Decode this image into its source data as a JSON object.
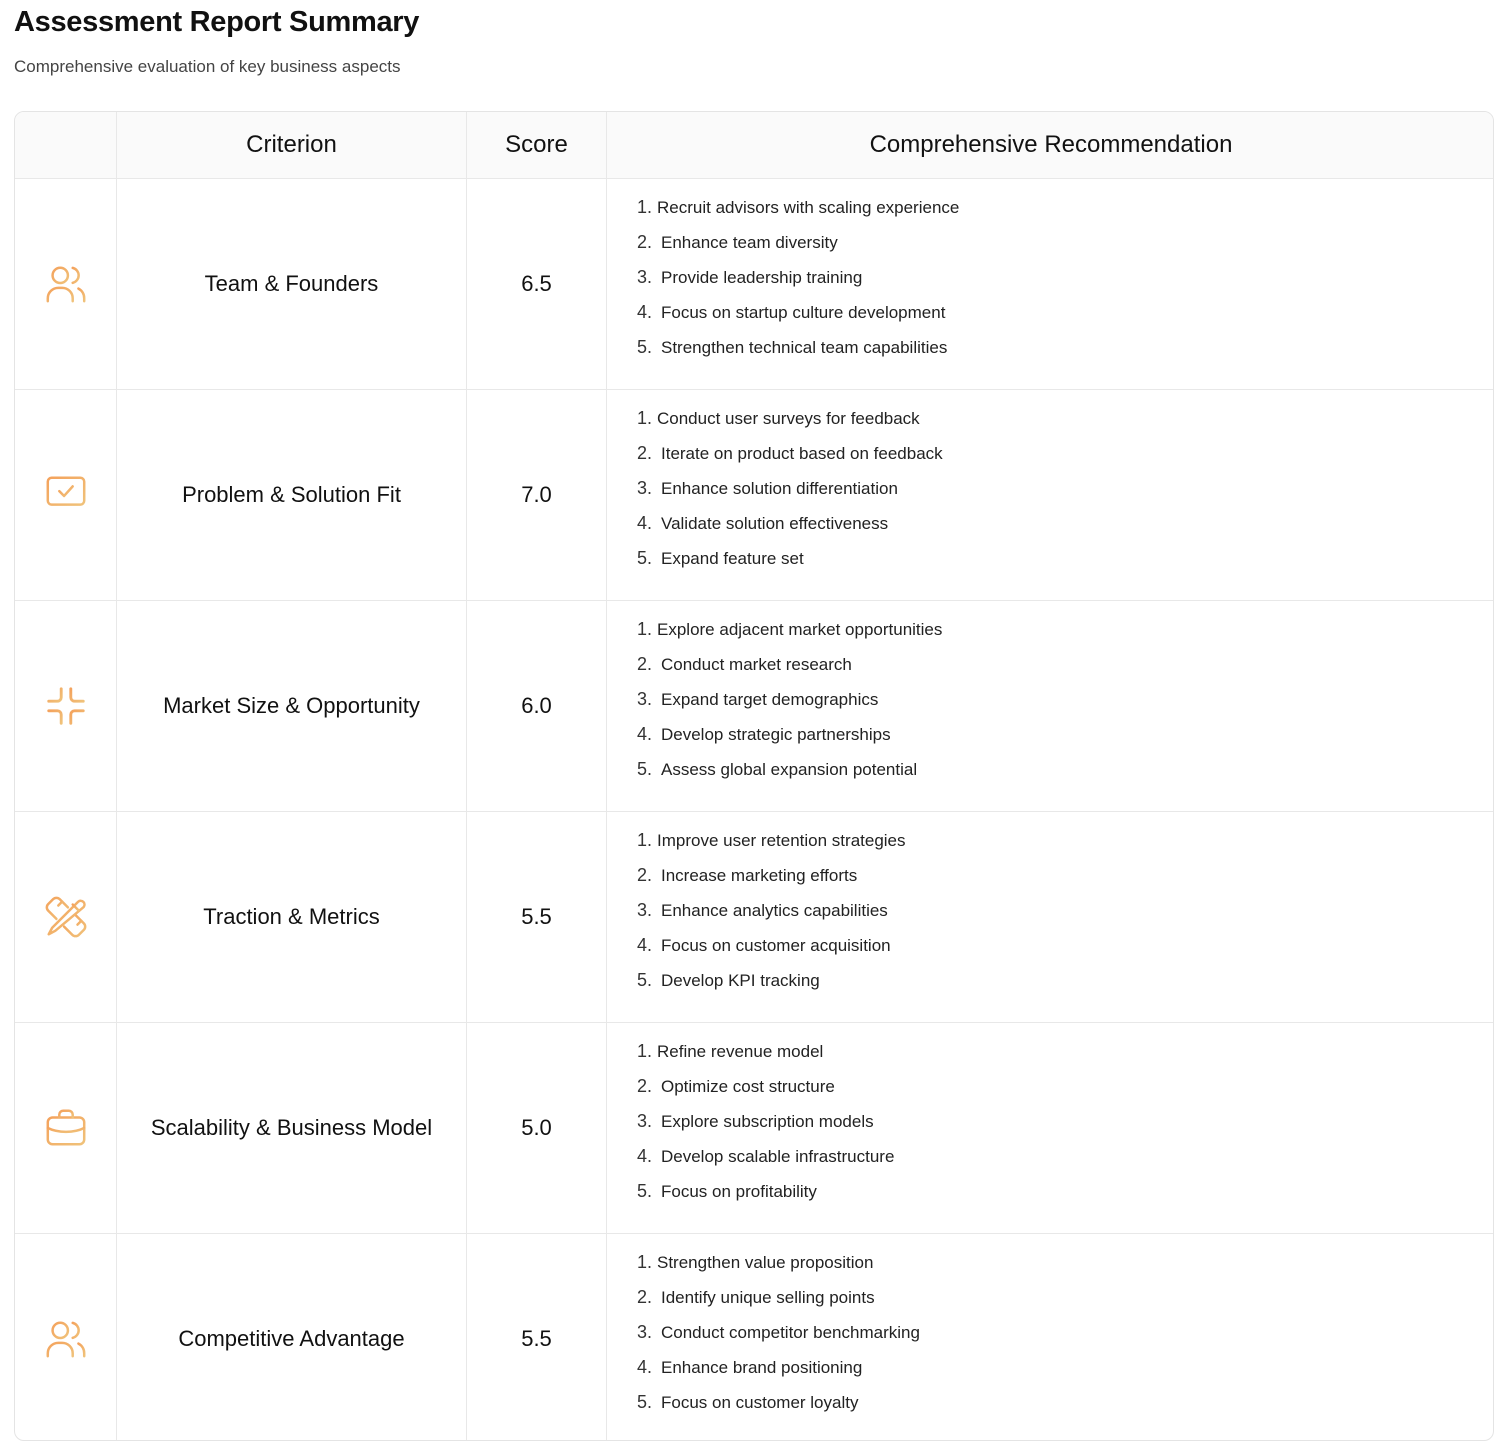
{
  "header": {
    "title": "Assessment Report Summary",
    "subtitle": "Comprehensive evaluation of key business aspects"
  },
  "table": {
    "columns": [
      "",
      "Criterion",
      "Score",
      "Comprehensive Recommendation"
    ],
    "rows": [
      {
        "icon": "users-icon",
        "criterion": "Team & Founders",
        "score": "6.5",
        "recommendations": [
          "Recruit advisors with scaling experience",
          "Enhance team diversity",
          "Provide leadership training",
          "Focus on startup culture development",
          "Strengthen technical team capabilities"
        ]
      },
      {
        "icon": "monitor-check-icon",
        "criterion": "Problem & Solution Fit",
        "score": "7.0",
        "recommendations": [
          "Conduct user surveys for feedback",
          "Iterate on product based on feedback",
          "Enhance solution differentiation",
          "Validate solution effectiveness",
          "Expand feature set"
        ]
      },
      {
        "icon": "minimize-icon",
        "criterion": "Market Size & Opportunity",
        "score": "6.0",
        "recommendations": [
          "Explore adjacent market opportunities",
          "Conduct market research",
          "Expand target demographics",
          "Develop strategic partnerships",
          "Assess global expansion potential"
        ]
      },
      {
        "icon": "pencil-ruler-icon",
        "criterion": "Traction & Metrics",
        "score": "5.5",
        "recommendations": [
          "Improve user retention strategies",
          "Increase marketing efforts",
          "Enhance analytics capabilities",
          "Focus on customer acquisition",
          "Develop KPI tracking"
        ]
      },
      {
        "icon": "briefcase-icon",
        "criterion": "Scalability & Business Model",
        "score": "5.0",
        "recommendations": [
          "Refine revenue model",
          "Optimize cost structure",
          "Explore subscription models",
          "Develop scalable infrastructure",
          "Focus on profitability"
        ]
      },
      {
        "icon": "users-icon",
        "criterion": "Competitive Advantage",
        "score": "5.5",
        "recommendations": [
          "Strengthen value proposition",
          "Identify unique selling points",
          "Conduct competitor benchmarking",
          "Enhance brand positioning",
          "Focus on customer loyalty"
        ]
      }
    ]
  },
  "colors": {
    "icon_gradient_start": "#f4a25c",
    "icon_gradient_end": "#f0c27a"
  }
}
